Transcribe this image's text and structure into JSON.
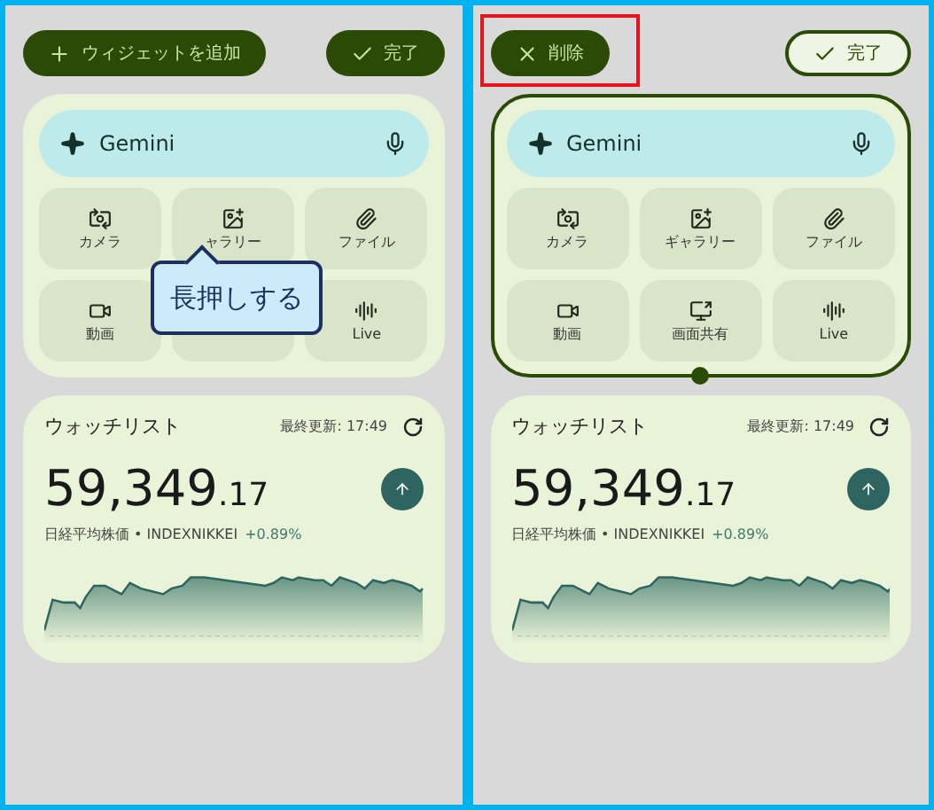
{
  "screens": [
    {
      "toolbar": {
        "buttons": [
          {
            "kind": "add",
            "label": "ウィジェットを追加",
            "outlined": false,
            "highlighted": false
          },
          {
            "kind": "done",
            "label": "完了",
            "outlined": false,
            "highlighted": false
          }
        ]
      },
      "widget": {
        "selected": false,
        "search": {
          "label": "Gemini"
        },
        "tiles": [
          {
            "kind": "camera",
            "label": "カメラ"
          },
          {
            "kind": "gallery",
            "label": "ャラリー"
          },
          {
            "kind": "file",
            "label": "ファイル"
          },
          {
            "kind": "video",
            "label": "動画"
          },
          {
            "kind": "covered"
          },
          {
            "kind": "live",
            "label": "Live"
          }
        ]
      },
      "tooltip": {
        "text": "長押しする"
      },
      "watchlist": {
        "title": "ウォッチリスト",
        "updated": "最終更新: 17:49",
        "value": "59,349",
        "decimals": ".17",
        "index": "日経平均株価 • INDEXNIKKEI",
        "change": "+0.89%"
      }
    },
    {
      "toolbar": {
        "buttons": [
          {
            "kind": "delete",
            "label": "削除",
            "outlined": false,
            "highlighted": true
          },
          {
            "kind": "done",
            "label": "完了",
            "outlined": true,
            "highlighted": false
          }
        ]
      },
      "widget": {
        "selected": true,
        "search": {
          "label": "Gemini"
        },
        "tiles": [
          {
            "kind": "camera",
            "label": "カメラ"
          },
          {
            "kind": "gallery",
            "label": "ギャラリー"
          },
          {
            "kind": "file",
            "label": "ファイル"
          },
          {
            "kind": "video",
            "label": "動画"
          },
          {
            "kind": "screen",
            "label": "画面共有"
          },
          {
            "kind": "live",
            "label": "Live"
          }
        ]
      },
      "watchlist": {
        "title": "ウォッチリスト",
        "updated": "最終更新: 17:49",
        "value": "59,349",
        "decimals": ".17",
        "index": "日経平均株価 • INDEXNIKKEI",
        "change": "+0.89%"
      }
    }
  ]
}
